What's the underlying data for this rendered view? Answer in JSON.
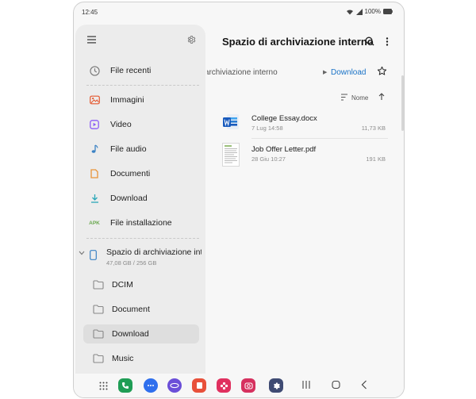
{
  "status_bar": {
    "time": "12:45",
    "battery": "100%"
  },
  "sidebar": {
    "items": [
      {
        "label": "File recenti",
        "icon": "clock-icon"
      },
      {
        "label": "Immagini",
        "icon": "image-icon"
      },
      {
        "label": "Video",
        "icon": "video-icon"
      },
      {
        "label": "File audio",
        "icon": "music-note-icon"
      },
      {
        "label": "Documenti",
        "icon": "document-icon"
      },
      {
        "label": "Download",
        "icon": "download-icon"
      },
      {
        "label": "File installazione",
        "icon": "apk-icon",
        "icon_text": "APK"
      }
    ],
    "storage": {
      "name": "Spazio di archiviazione interno",
      "usage": "47,08 GB / 256 GB"
    },
    "folders": [
      {
        "label": "DCIM"
      },
      {
        "label": "Document"
      },
      {
        "label": "Download",
        "selected": true
      },
      {
        "label": "Music"
      }
    ]
  },
  "main": {
    "title": "Spazio di archiviazione interno",
    "breadcrumb": {
      "parent": "Spazio di archiviazione interno",
      "current": "Download"
    },
    "sort": {
      "label": "Nome"
    },
    "files": [
      {
        "name": "College Essay.docx",
        "date": "7 Lug 14:58",
        "size": "11,73 KB",
        "type": "word-document-icon"
      },
      {
        "name": "Job Offer Letter.pdf",
        "date": "28 Giu 10:27",
        "size": "191 KB",
        "type": "pdf-thumbnail"
      }
    ]
  },
  "dock": {
    "apps": [
      "app-drawer-icon",
      "phone-app-icon",
      "messages-app-icon",
      "internet-app-icon",
      "notes-app-icon",
      "gallery-app-icon",
      "camera-app-icon",
      "settings-app-icon"
    ],
    "nav": [
      "recents-nav-icon",
      "home-nav-icon",
      "back-nav-icon"
    ]
  },
  "colors": {
    "accent": "#1a73c7",
    "sidebar_bg": "#ececec",
    "selected_bg": "#dedede"
  }
}
